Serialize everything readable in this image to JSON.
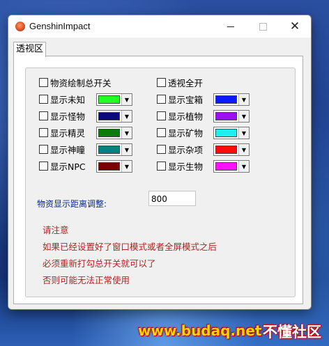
{
  "window": {
    "title": "GenshinImpact"
  },
  "tabs": [
    {
      "label": "透视区"
    }
  ],
  "toggles": {
    "master": "物资绘制总开关",
    "fullview": "透视全开"
  },
  "left_items": [
    {
      "label": "显示未知",
      "color": "#22ff22"
    },
    {
      "label": "显示怪物",
      "color": "#0a0a7a"
    },
    {
      "label": "显示精灵",
      "color": "#0c7a0c"
    },
    {
      "label": "显示神瞳",
      "color": "#0a7f7f"
    },
    {
      "label": "显示NPC",
      "color": "#7a0000"
    }
  ],
  "right_items": [
    {
      "label": "显示宝箱",
      "color": "#0a1aff"
    },
    {
      "label": "显示植物",
      "color": "#9b10f0"
    },
    {
      "label": "显示矿物",
      "color": "#1ef0f0"
    },
    {
      "label": "显示杂项",
      "color": "#ff0a0a"
    },
    {
      "label": "显示生物",
      "color": "#ff10ff"
    }
  ],
  "distance": {
    "label": "物资显示距离调整:",
    "value": "800"
  },
  "notes": [
    "请注意",
    "如果已经设置好了窗口模式或者全屏模式之后",
    "必须重新打勾总开关就可以了",
    "否则可能无法正常使用"
  ],
  "watermark": {
    "url": "www.budaq.net",
    "brand": "不懂社区"
  }
}
